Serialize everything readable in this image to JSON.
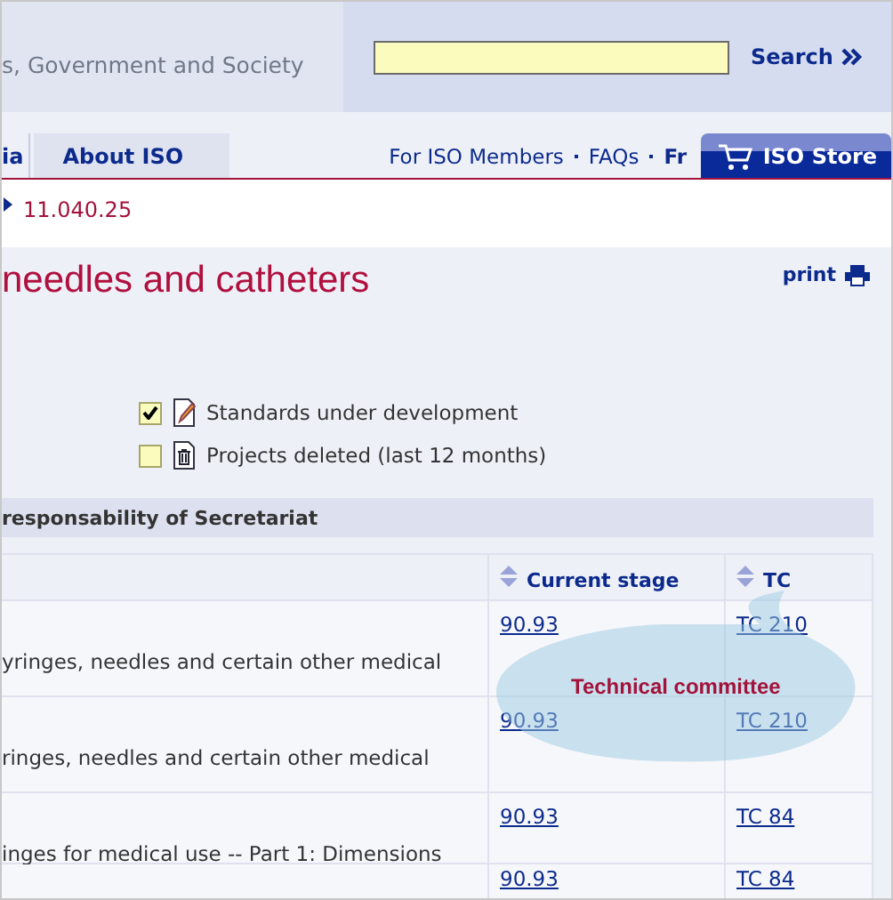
{
  "header": {
    "tagline": "s, Government and Society",
    "search_button": "Search"
  },
  "nav": {
    "tabs": [
      {
        "label": "ia",
        "selected": false
      },
      {
        "label": "About ISO",
        "selected": true
      }
    ],
    "links": [
      {
        "label": "For ISO Members",
        "emphasized": false
      },
      {
        "label": "FAQs",
        "emphasized": false
      },
      {
        "label": "Fr",
        "emphasized": true
      }
    ],
    "store": "ISO Store"
  },
  "breadcrumb": "11.040.25",
  "title": "needles and catheters",
  "print": "print",
  "filters": [
    {
      "label": "Standards under development",
      "checked": true,
      "kind": "pencil"
    },
    {
      "label": "Projects deleted (last 12 months)",
      "checked": false,
      "kind": "trash"
    }
  ],
  "section_title": "responsability of Secretariat",
  "table": {
    "columns": [
      "Current stage",
      "TC"
    ],
    "rows": [
      {
        "title": "yringes, needles and certain other medical",
        "stage": "90.93",
        "tc": "TC 210"
      },
      {
        "title": "ringes, needles and certain other medical",
        "stage": "90.93",
        "tc": "TC 210"
      },
      {
        "title": "inges for medical use -- Part 1: Dimensions",
        "stage": "90.93",
        "tc": "TC 84"
      },
      {
        "stage": "90.93",
        "tc": "TC 84"
      }
    ]
  },
  "callout": "Technical committee"
}
